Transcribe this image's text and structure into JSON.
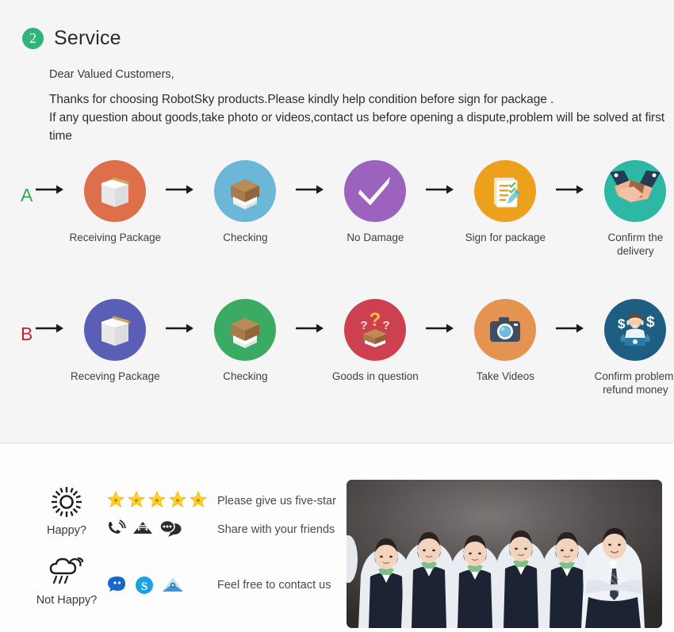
{
  "section": {
    "number": "2",
    "title": "Service",
    "badge_color": "#2fb57a"
  },
  "intro": {
    "greeting": "Dear Valued Customers,",
    "body": "Thanks for choosing RobotSky products.Please kindly help condition before sign for package .\nIf any question about goods,take photo or videos,contact us before opening a dispute,problem will be solved at first time"
  },
  "flows": [
    {
      "tag": "A",
      "tag_color": "#36a853",
      "steps": [
        {
          "label": "Receiving Package",
          "icon": "package-box-icon",
          "color": "#dd6f4a"
        },
        {
          "label": "Checking",
          "icon": "open-box-icon",
          "color": "#6cb7d8"
        },
        {
          "label": "No Damage",
          "icon": "checkmark-icon",
          "color": "#9b63bd"
        },
        {
          "label": "Sign for package",
          "icon": "signed-document-icon",
          "color": "#eda01c"
        },
        {
          "label": "Confirm the delivery",
          "icon": "handshake-icon",
          "color": "#2db7a5"
        }
      ]
    },
    {
      "tag": "B",
      "tag_color": "#c0272d",
      "steps": [
        {
          "label": "Receving Package",
          "icon": "package-box-icon",
          "color": "#5a5fb5"
        },
        {
          "label": "Checking",
          "icon": "open-box-icon",
          "color": "#3bab63"
        },
        {
          "label": "Goods in question",
          "icon": "question-box-icon",
          "color": "#cc4050"
        },
        {
          "label": "Take Videos",
          "icon": "camera-icon",
          "color": "#e59350"
        },
        {
          "label": "Confirm problem,\nrefund money",
          "icon": "support-agent-icon",
          "color": "#1f5e83"
        }
      ]
    }
  ],
  "contact": {
    "rows": [
      {
        "mood_label": "Happy?",
        "mood_icon": "sun-icon",
        "lines": [
          {
            "icons": [
              "star-icon",
              "star-icon",
              "star-icon",
              "star-icon",
              "star-icon"
            ],
            "text": "Please give us five-star"
          },
          {
            "icons": [
              "phone-icon",
              "envelope-icon",
              "chat-bubbles-icon"
            ],
            "text": "Share with your friends"
          }
        ]
      },
      {
        "mood_label": "Not Happy?",
        "mood_icon": "rain-cloud-icon",
        "lines": [
          {
            "icons": [
              "trademanager-icon",
              "skype-icon",
              "mail-envelope-icon"
            ],
            "text": "Feel free to contact us"
          }
        ]
      }
    ]
  },
  "photo": {
    "alt": "customer-service-team-photo",
    "people": 6
  }
}
